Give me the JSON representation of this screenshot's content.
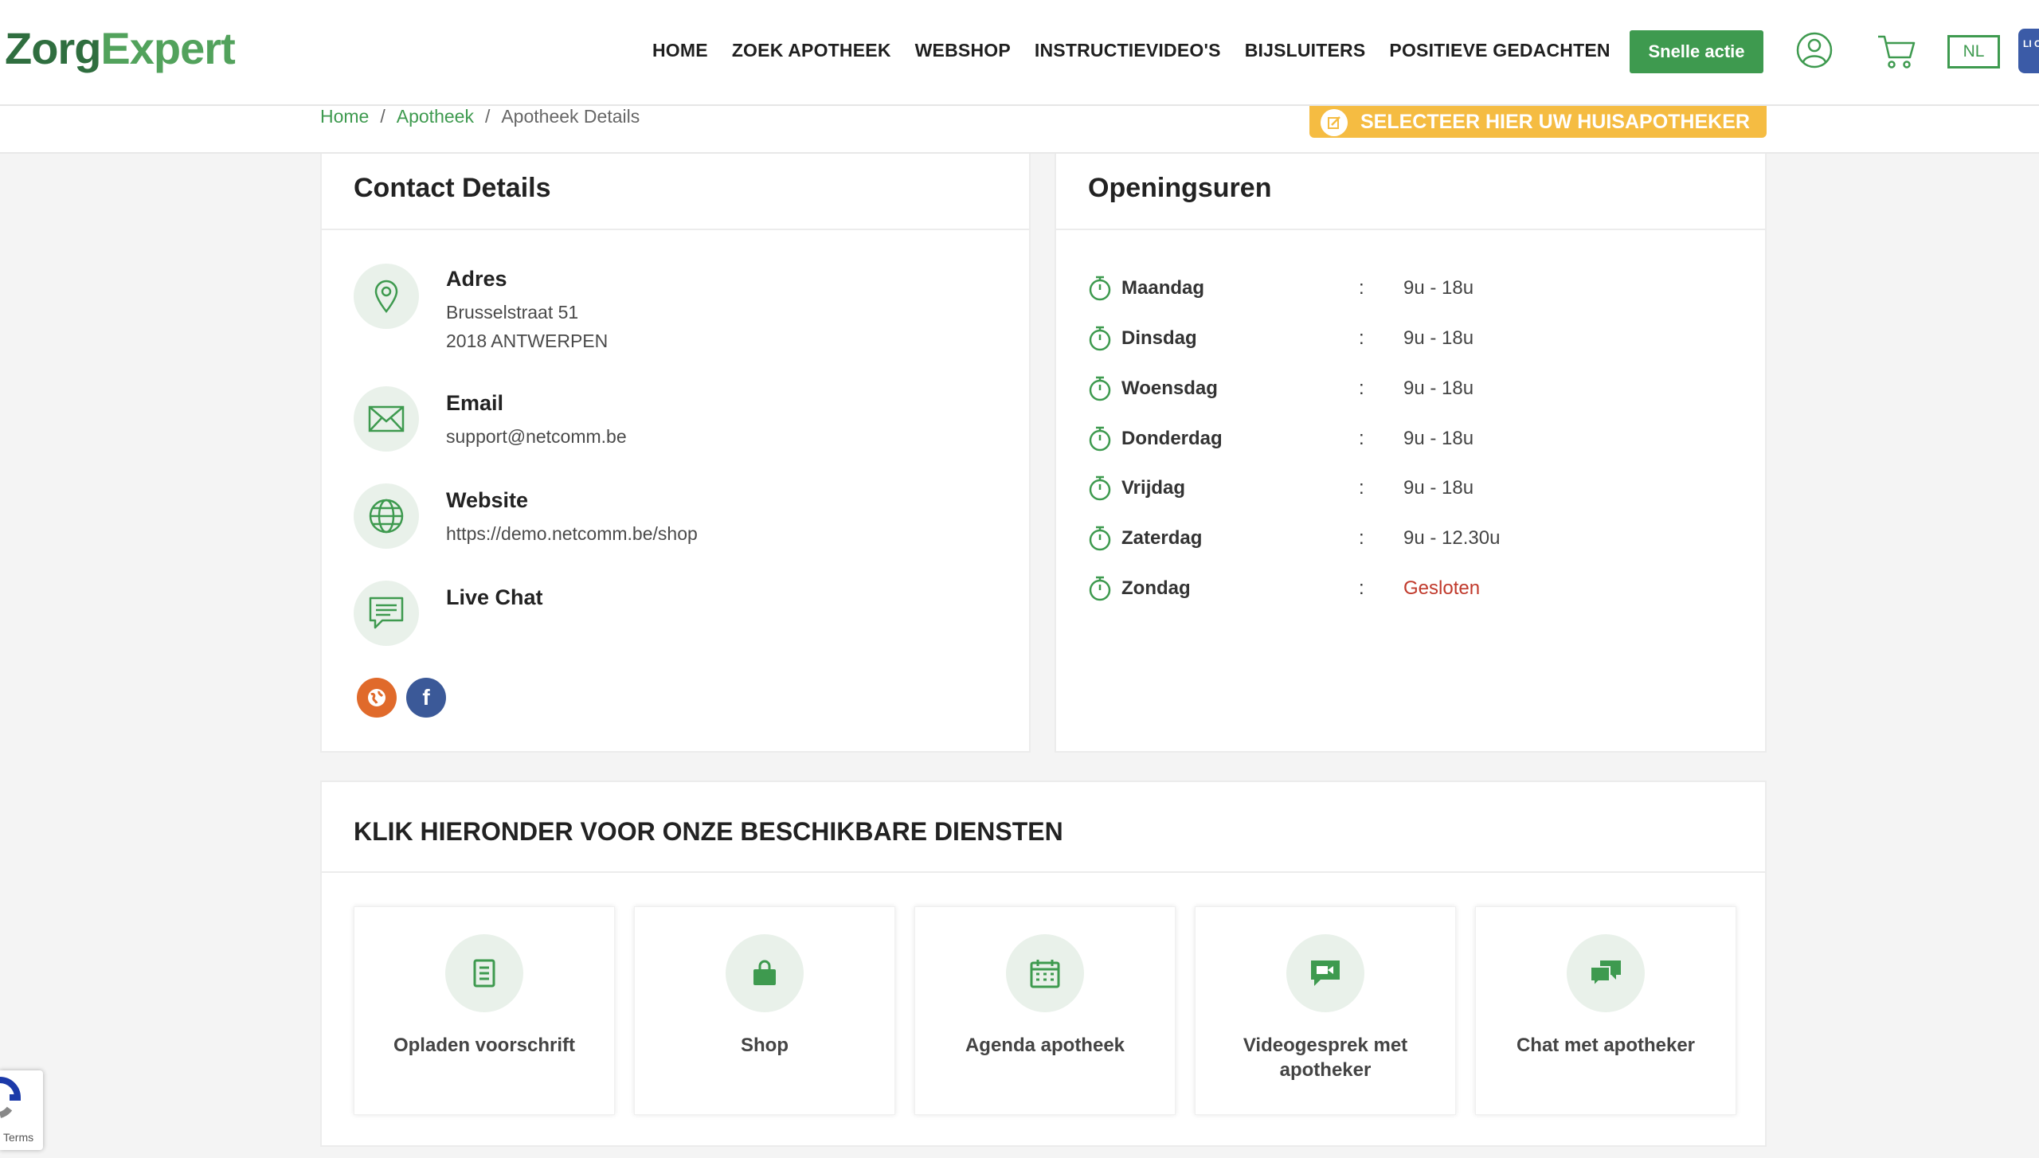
{
  "header": {
    "logo_part1": "Zorg",
    "logo_part2": "Expert",
    "nav": [
      "HOME",
      "ZOEK APOTHEEK",
      "WEBSHOP",
      "INSTRUCTIEVIDEO'S",
      "BIJSLUITERS",
      "POSITIEVE GEDACHTEN"
    ],
    "quick_action": "Snelle actie",
    "language": "NL",
    "corner_badge": "LI OF"
  },
  "breadcrumb": {
    "home": "Home",
    "sep": "/",
    "apotheek": "Apotheek",
    "current": "Apotheek Details"
  },
  "select_pharmacy_button": "SELECTEER HIER UW HUISAPOTHEKER",
  "contact": {
    "title": "Contact Details",
    "address_label": "Adres",
    "address_line1": "Brusselstraat 51",
    "address_line2": "2018 ANTWERPEN",
    "email_label": "Email",
    "email_value": "support@netcomm.be",
    "website_label": "Website",
    "website_value": "https://demo.netcomm.be/shop",
    "livechat_label": "Live Chat",
    "social": [
      "website",
      "facebook"
    ]
  },
  "hours": {
    "title": "Openingsuren",
    "colon": ":",
    "rows": [
      {
        "day": "Maandag",
        "time": "9u - 18u"
      },
      {
        "day": "Dinsdag",
        "time": "9u - 18u"
      },
      {
        "day": "Woensdag",
        "time": "9u - 18u"
      },
      {
        "day": "Donderdag",
        "time": "9u - 18u"
      },
      {
        "day": "Vrijdag",
        "time": "9u - 18u"
      },
      {
        "day": "Zaterdag",
        "time": "9u - 12.30u"
      },
      {
        "day": "Zondag",
        "time": "Gesloten"
      }
    ]
  },
  "services": {
    "title": "KLIK HIERONDER VOOR ONZE BESCHIKBARE DIENSTEN",
    "items": [
      {
        "label": "Opladen voorschrift",
        "icon": "prescription-icon"
      },
      {
        "label": "Shop",
        "icon": "shopping-bag-icon"
      },
      {
        "label": "Agenda apotheek",
        "icon": "calendar-icon"
      },
      {
        "label": "Videogesprek met apotheker",
        "icon": "video-call-icon"
      },
      {
        "label": "Chat met apotheker",
        "icon": "chat-icon"
      }
    ]
  },
  "recaptcha": {
    "terms": "Terms"
  },
  "colors": {
    "brand_green": "#3e9a4f",
    "accent_yellow": "#f5bc42",
    "closed_red": "#c0392b"
  }
}
